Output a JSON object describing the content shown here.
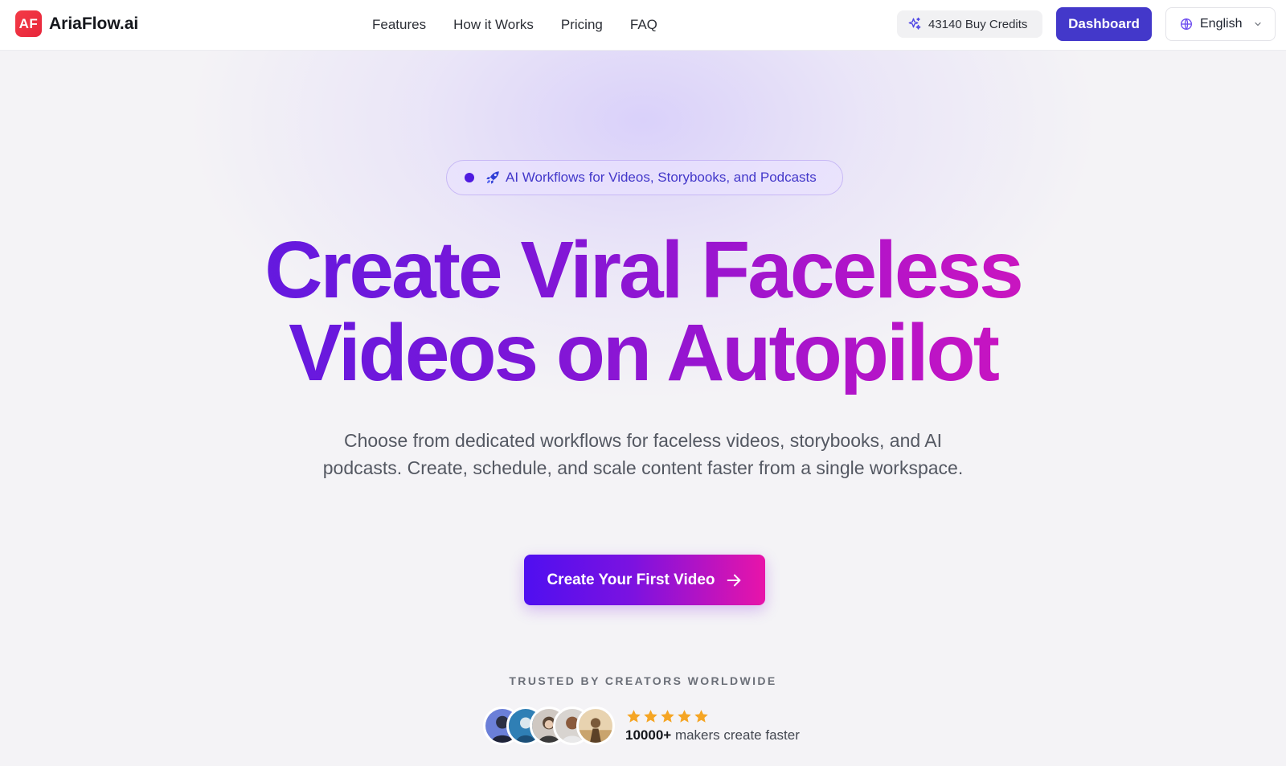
{
  "brand": {
    "logo_mark": "AF",
    "name": "AriaFlow.ai"
  },
  "nav": {
    "items": [
      {
        "label": "Features"
      },
      {
        "label": "How it Works"
      },
      {
        "label": "Pricing"
      },
      {
        "label": "FAQ"
      }
    ]
  },
  "header": {
    "credits_label": "43140 Buy Credits",
    "credits_icon": "sparkles-icon",
    "dashboard_label": "Dashboard",
    "language_label": "English"
  },
  "hero": {
    "badge_label": "AI Workflows for Videos, Storybooks, and Podcasts",
    "badge_icon": "rocket-icon",
    "headline_line1": "Create Viral Faceless",
    "headline_line2": "Videos on Autopilot",
    "subtitle": "Choose from dedicated workflows for faceless videos, storybooks, and AI podcasts. Create, schedule, and scale content faster from a single workspace.",
    "cta_label": "Create Your First Video"
  },
  "social_proof": {
    "heading": "TRUSTED BY CREATORS WORLDWIDE",
    "rating_stars": 5,
    "count": "10000+",
    "caption": "makers create faster"
  },
  "colors": {
    "accent": "#4338ca",
    "gradient_start": "#4f0ff0",
    "gradient_end": "#e814a9",
    "star": "#f5a524",
    "logo_red": "#f43b47"
  }
}
